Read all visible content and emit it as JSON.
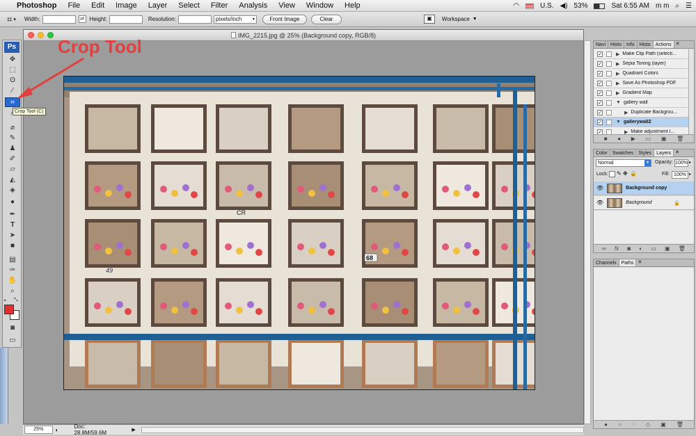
{
  "menubar": {
    "app": "Photoshop",
    "items": [
      "File",
      "Edit",
      "Image",
      "Layer",
      "Select",
      "Filter",
      "Analysis",
      "View",
      "Window",
      "Help"
    ],
    "battery": "53%",
    "input": "U.S.",
    "clock": "Sat 6:55 AM",
    "user": "m m"
  },
  "options": {
    "width_label": "Width:",
    "height_label": "Height:",
    "resolution_label": "Resolution:",
    "units": "pixels/inch",
    "front_image": "Front Image",
    "clear": "Clear",
    "workspace": "Workspace"
  },
  "toolbox": {
    "logo": "Ps"
  },
  "tooltip": "Crop Tool (C)",
  "annotation": "Crop Tool",
  "document": {
    "title": "IMG_2215.jpg @ 25% (Background copy, RGB/8)",
    "labels": [
      "CR",
      "49",
      "68"
    ]
  },
  "status": {
    "zoom": "25%",
    "doc": "Doc: 28.8M/59.6M"
  },
  "actions_panel": {
    "tabs": [
      "Navi",
      "Histo",
      "Info",
      "Histo",
      "Actions"
    ],
    "items": [
      {
        "label": "Make Clip Path (selecti...",
        "tri": "▶"
      },
      {
        "label": "Sepia Toning (layer)",
        "tri": "▶"
      },
      {
        "label": "Quadrant Colors",
        "tri": "▶"
      },
      {
        "label": "Save As Photoshop PDF",
        "tri": "▶"
      },
      {
        "label": "Gradient Map",
        "tri": "▶"
      },
      {
        "label": "gallery wall",
        "tri": "▼"
      },
      {
        "label": "Duplicate Backgrou...",
        "tri": "▶"
      },
      {
        "label": "gallerywall2",
        "tri": "▼"
      },
      {
        "label": "Make adjustment l...",
        "tri": "▶"
      }
    ]
  },
  "layers_panel": {
    "tabs": [
      "Color",
      "Swatches",
      "Styles",
      "Layers"
    ],
    "blend_mode": "Normal",
    "opacity_label": "Opacity:",
    "opacity": "100%",
    "lock_label": "Lock:",
    "fill_label": "Fill:",
    "fill": "100%",
    "layers": [
      "Background copy",
      "Background"
    ]
  },
  "channels_panel": {
    "tabs": [
      "Channels",
      "Paths"
    ]
  },
  "colors": {
    "accent": "#e04040",
    "selection": "#b4d2ef",
    "wall_blue": "#1f5f94"
  }
}
